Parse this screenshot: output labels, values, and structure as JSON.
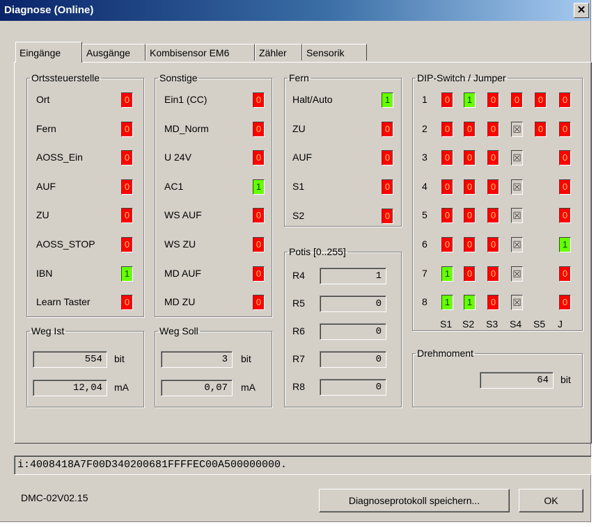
{
  "window": {
    "title": "Diagnose (Online)",
    "close_glyph": "✕"
  },
  "tabs": [
    "Eingänge",
    "Ausgänge",
    "Kombisensor EM6",
    "Zähler",
    "Sensorik"
  ],
  "ortssteuerstelle": {
    "legend": "Ortssteuerstelle",
    "rows": [
      {
        "label": "Ort",
        "value": "0"
      },
      {
        "label": "Fern",
        "value": "0"
      },
      {
        "label": "AOSS_Ein",
        "value": "0"
      },
      {
        "label": "AUF",
        "value": "0"
      },
      {
        "label": "ZU",
        "value": "0"
      },
      {
        "label": "AOSS_STOP",
        "value": "0"
      },
      {
        "label": "IBN",
        "value": "1"
      },
      {
        "label": "Learn Taster",
        "value": "0"
      }
    ]
  },
  "sonstige": {
    "legend": "Sonstige",
    "rows": [
      {
        "label": "Ein1 (CC)",
        "value": "0"
      },
      {
        "label": "MD_Norm",
        "value": "0"
      },
      {
        "label": "U 24V",
        "value": "0"
      },
      {
        "label": "AC1",
        "value": "1"
      },
      {
        "label": "WS AUF",
        "value": "0"
      },
      {
        "label": "WS ZU",
        "value": "0"
      },
      {
        "label": "MD AUF",
        "value": "0"
      },
      {
        "label": "MD ZU",
        "value": "0"
      }
    ]
  },
  "fern": {
    "legend": "Fern",
    "rows": [
      {
        "label": "Halt/Auto",
        "value": "1"
      },
      {
        "label": "ZU",
        "value": "0"
      },
      {
        "label": "AUF",
        "value": "0"
      },
      {
        "label": "S1",
        "value": "0"
      },
      {
        "label": "S2",
        "value": "0"
      }
    ]
  },
  "potis": {
    "legend": "Potis [0..255]",
    "rows": [
      {
        "label": "R4",
        "value": "1"
      },
      {
        "label": "R5",
        "value": "0"
      },
      {
        "label": "R6",
        "value": "0"
      },
      {
        "label": "R7",
        "value": "0"
      },
      {
        "label": "R8",
        "value": "0"
      }
    ]
  },
  "dip": {
    "legend": "DIP-Switch / Jumper",
    "row_labels": [
      "1",
      "2",
      "3",
      "4",
      "5",
      "6",
      "7",
      "8"
    ],
    "col_labels": [
      "S1",
      "S2",
      "S3",
      "S4",
      "S5",
      "J"
    ],
    "grid": [
      [
        "0",
        "1",
        "0",
        "0",
        "0",
        "0"
      ],
      [
        "0",
        "0",
        "0",
        "X",
        "0",
        "0"
      ],
      [
        "0",
        "0",
        "0",
        "X",
        "",
        "0"
      ],
      [
        "0",
        "0",
        "0",
        "X",
        "",
        "0"
      ],
      [
        "0",
        "0",
        "0",
        "X",
        "",
        "0"
      ],
      [
        "0",
        "0",
        "0",
        "X",
        "",
        "1"
      ],
      [
        "1",
        "0",
        "0",
        "X",
        "",
        "0"
      ],
      [
        "1",
        "1",
        "0",
        "X",
        "",
        "0"
      ]
    ],
    "x_glyph": "☒"
  },
  "weg_ist": {
    "legend": "Weg Ist",
    "value1": "554",
    "unit1": "bit",
    "value2": "12,04",
    "unit2": "mA"
  },
  "weg_soll": {
    "legend": "Weg Soll",
    "value1": "3",
    "unit1": "bit",
    "value2": "0,07",
    "unit2": "mA"
  },
  "drehmoment": {
    "legend": "Drehmoment",
    "value": "64",
    "unit": "bit"
  },
  "hex_status": "i:4008418A7F00D340200681FFFFEC00A500000000.",
  "footer": {
    "version": "DMC-02V02.15",
    "save_button": "Diagnoseprotokoll speichern...",
    "ok_button": "OK"
  },
  "colors": {
    "on": "#66ff00",
    "off": "#ff0000",
    "face": "#d4d0c8",
    "title_start": "#0a246a"
  }
}
